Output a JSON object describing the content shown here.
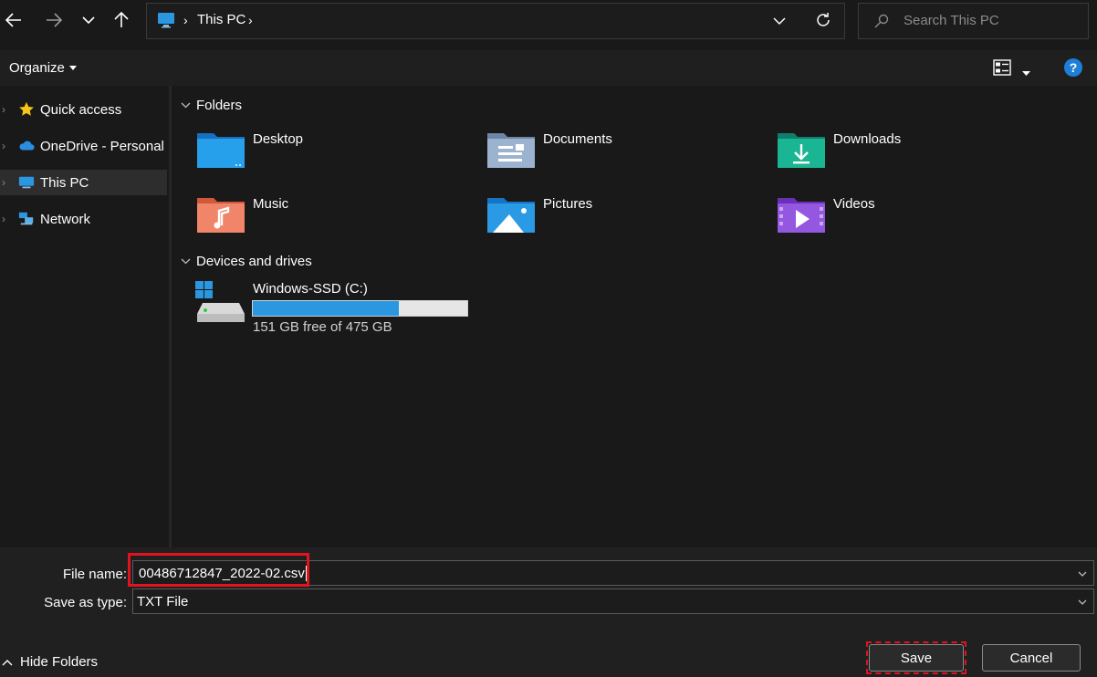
{
  "toolbar": {
    "back_icon": "arrow-left-icon",
    "forward_icon": "arrow-right-icon",
    "recent_icon": "chevron-down-icon",
    "up_icon": "arrow-up-icon",
    "breadcrumb_root": "This PC",
    "refresh_icon": "refresh-icon",
    "search_placeholder": "Search This PC"
  },
  "commandbar": {
    "organize_label": "Organize",
    "view_icon": "view-layout-icon",
    "help_icon": "help-icon",
    "help_glyph": "?"
  },
  "nav": {
    "items": [
      {
        "label": "Quick access",
        "icon": "star-icon"
      },
      {
        "label": "OneDrive - Personal",
        "icon": "cloud-icon"
      },
      {
        "label": "This PC",
        "icon": "monitor-icon",
        "selected": true
      },
      {
        "label": "Network",
        "icon": "network-icon"
      }
    ]
  },
  "content": {
    "folders_header": "Folders",
    "folders": [
      {
        "label": "Desktop",
        "icon": "desktop-folder-icon",
        "color": "#1f8fdc"
      },
      {
        "label": "Documents",
        "icon": "documents-folder-icon",
        "color": "#8aa2bf"
      },
      {
        "label": "Downloads",
        "icon": "downloads-folder-icon",
        "color": "#1aa58a"
      },
      {
        "label": "Music",
        "icon": "music-folder-icon",
        "color": "#e9745a"
      },
      {
        "label": "Pictures",
        "icon": "pictures-folder-icon",
        "color": "#2a97e0"
      },
      {
        "label": "Videos",
        "icon": "videos-folder-icon",
        "color": "#8b4fd6"
      }
    ],
    "drives_header": "Devices and drives",
    "drives": [
      {
        "label": "Windows-SSD (C:)",
        "free_text": "151 GB free of 475 GB",
        "used_fraction": 0.682,
        "icon": "hard-drive-icon",
        "bar_color": "#2a97e0"
      }
    ]
  },
  "footer": {
    "filename_label": "File name:",
    "filename_value": "00486712847_2022-02.csv",
    "savetype_label": "Save as type:",
    "savetype_value": "TXT File",
    "hide_folders_label": "Hide Folders",
    "save_label": "Save",
    "cancel_label": "Cancel"
  },
  "colors": {
    "accent": "#2a97e0",
    "highlight_red": "#e0141e",
    "background": "#191919"
  }
}
